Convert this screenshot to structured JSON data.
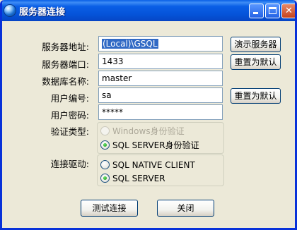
{
  "window": {
    "title": "服务器连接"
  },
  "title_buttons": {
    "close": "✕"
  },
  "form": {
    "server_address": {
      "label": "服务器地址:",
      "value": "(Local)\\GSQL"
    },
    "server_port": {
      "label": "服务器端口:",
      "value": "1433"
    },
    "database_name": {
      "label": "数据库名称:",
      "value": "master"
    },
    "user_id": {
      "label": "用户编号:",
      "value": "sa"
    },
    "password": {
      "label": "用户密码:",
      "value": "*****"
    },
    "auth_type": {
      "label": "验证类型:",
      "options": [
        {
          "label": "Windows身份验证",
          "checked": false,
          "disabled": true
        },
        {
          "label": "SQL SERVER身份验证",
          "checked": true,
          "disabled": false
        }
      ]
    },
    "driver": {
      "label": "连接驱动:",
      "options": [
        {
          "label": "SQL NATIVE CLIENT",
          "checked": false,
          "disabled": false
        },
        {
          "label": "SQL SERVER",
          "checked": true,
          "disabled": false
        }
      ]
    }
  },
  "side_buttons": {
    "show_servers": "演示服务器",
    "reset_default_1": "重置为默认",
    "reset_default_2": "重置为默认"
  },
  "footer": {
    "test_button": "测试连接",
    "close_button": "关闭"
  },
  "colors": {
    "titlebar": "#0a5fe6",
    "window_bg": "#ece9d8",
    "selection": "#316ac5",
    "radio_checked": "#21a121"
  }
}
